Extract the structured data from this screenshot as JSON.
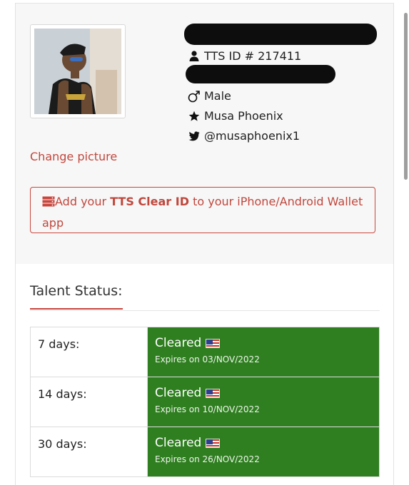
{
  "profile": {
    "tts_id": "TTS ID # 217411",
    "gender": "Male",
    "name": "Musa Phoenix",
    "twitter": "@musaphoenix1",
    "change_picture": "Change picture",
    "wallet_prefix": "Add your ",
    "wallet_bold": "TTS Clear ID",
    "wallet_suffix": " to your iPhone/Android Wallet app"
  },
  "status": {
    "title": "Talent Status:",
    "rows": [
      {
        "period": "7 days:",
        "state": "Cleared",
        "expires": "Expires on 03/NOV/2022"
      },
      {
        "period": "14 days:",
        "state": "Cleared",
        "expires": "Expires on 10/NOV/2022"
      },
      {
        "period": "30 days:",
        "state": "Cleared",
        "expires": "Expires on 26/NOV/2022"
      }
    ]
  },
  "colors": {
    "accent": "#c9463d",
    "cleared": "#2f7f21"
  },
  "icons": [
    "user-icon",
    "male-icon",
    "star-icon",
    "twitter-icon",
    "server-icon",
    "us-flag-icon"
  ]
}
